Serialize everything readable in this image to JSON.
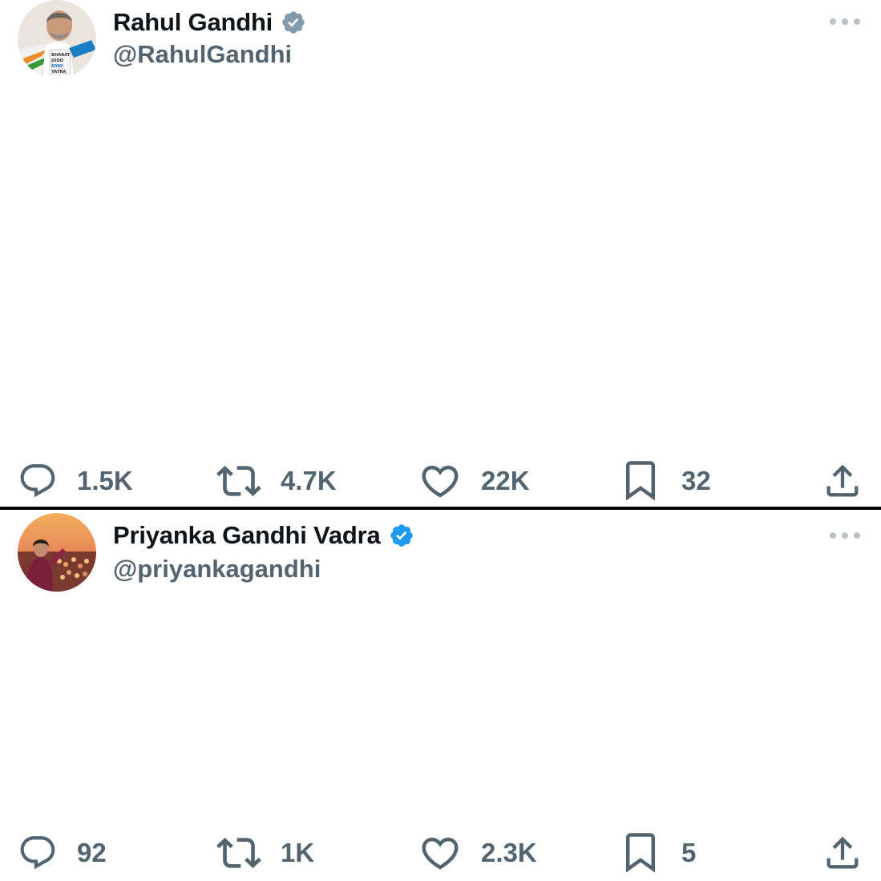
{
  "tweets": [
    {
      "display_name": "Rahul Gandhi",
      "handle": "@RahulGandhi",
      "verified_color": "#829aab",
      "replies": "1.5K",
      "retweets": "4.7K",
      "likes": "22K",
      "bookmarks": "32",
      "avatar_text": "BHARAT JODO NYAY YATRA"
    },
    {
      "display_name": "Priyanka Gandhi Vadra",
      "handle": "@priyankagandhi",
      "verified_color": "#1d9bf0",
      "replies": "92",
      "retweets": "1K",
      "likes": "2.3K",
      "bookmarks": "5"
    }
  ],
  "icons": {
    "reply": "reply-icon",
    "retweet": "retweet-icon",
    "like": "heart-icon",
    "bookmark": "bookmark-icon",
    "share": "share-icon",
    "more": "more-icon",
    "verified": "verified-badge-icon"
  },
  "colors": {
    "text_primary": "#0f1419",
    "text_secondary": "#536471",
    "divider": "#000000",
    "icon": "#536471"
  }
}
